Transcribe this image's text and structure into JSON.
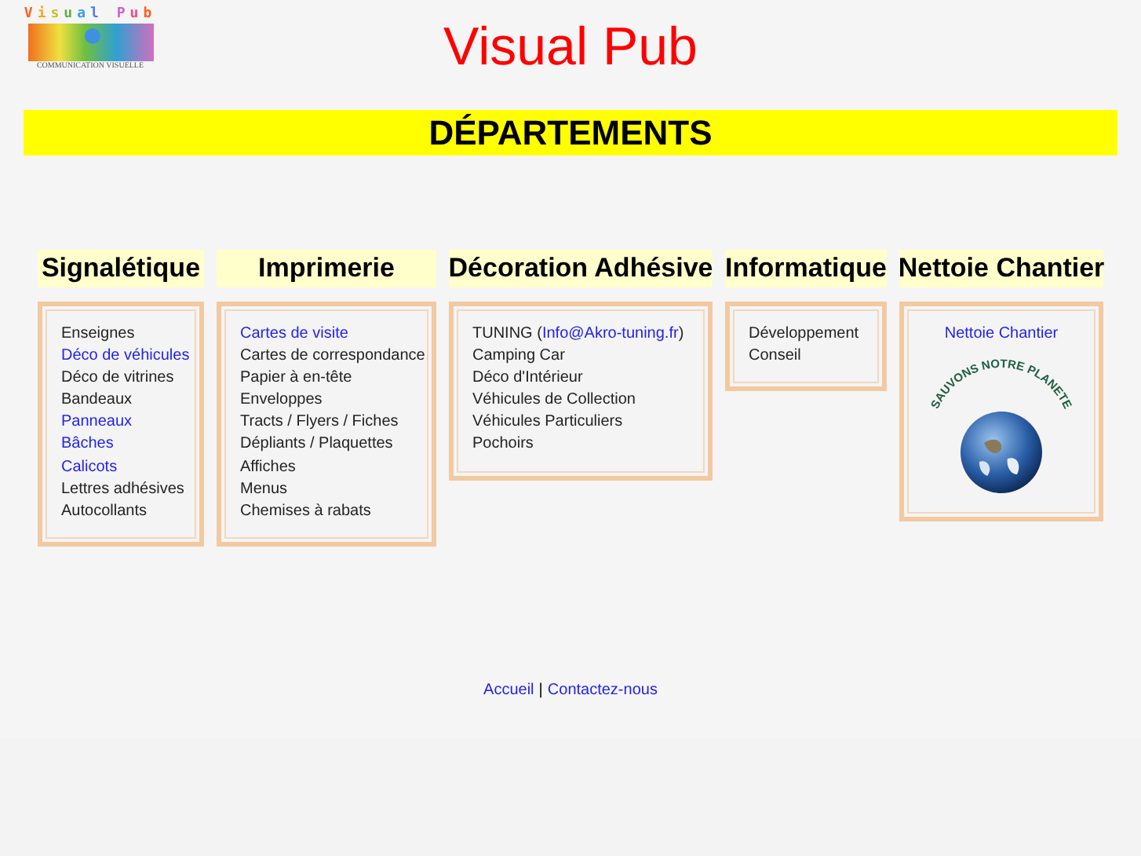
{
  "logo": {
    "name": "Visual Pub",
    "tagline": "COMMUNICATION VISUELLE"
  },
  "title": "Visual Pub",
  "banner": "DÉPARTEMENTS",
  "departments": [
    {
      "heading": "Signalétique",
      "kind": "list",
      "items": [
        {
          "parts": [
            {
              "text": "Enseignes",
              "link": false
            }
          ]
        },
        {
          "parts": [
            {
              "text": "Déco de véhicules",
              "link": true
            }
          ]
        },
        {
          "parts": [
            {
              "text": "Déco de vitrines",
              "link": false
            }
          ]
        },
        {
          "parts": [
            {
              "text": "Bandeaux",
              "link": false
            }
          ]
        },
        {
          "parts": [
            {
              "text": "Panneaux",
              "link": true
            }
          ]
        },
        {
          "parts": [
            {
              "text": "Bâches",
              "link": true
            }
          ]
        },
        {
          "parts": [
            {
              "text": "Calicots",
              "link": true
            }
          ]
        },
        {
          "parts": [
            {
              "text": "Lettres adhésives",
              "link": false
            }
          ]
        },
        {
          "parts": [
            {
              "text": "Autocollants",
              "link": false
            }
          ]
        }
      ]
    },
    {
      "heading": "Imprimerie",
      "kind": "list",
      "items": [
        {
          "parts": [
            {
              "text": "Cartes de visite",
              "link": true
            }
          ]
        },
        {
          "parts": [
            {
              "text": "Cartes de correspondance",
              "link": false
            }
          ]
        },
        {
          "parts": [
            {
              "text": "Papier à en-tête",
              "link": false
            }
          ]
        },
        {
          "parts": [
            {
              "text": "Enveloppes",
              "link": false
            }
          ]
        },
        {
          "parts": [
            {
              "text": "Tracts / Flyers / Fiches",
              "link": false
            }
          ]
        },
        {
          "parts": [
            {
              "text": "Dépliants / Plaquettes",
              "link": false
            }
          ]
        },
        {
          "parts": [
            {
              "text": "Affiches",
              "link": false
            }
          ]
        },
        {
          "parts": [
            {
              "text": "Menus",
              "link": false
            }
          ]
        },
        {
          "parts": [
            {
              "text": "Chemises à rabats",
              "link": false
            }
          ]
        }
      ]
    },
    {
      "heading": "Décoration Adhésive",
      "kind": "list",
      "items": [
        {
          "parts": [
            {
              "text": "TUNING (",
              "link": false
            },
            {
              "text": "Info@Akro-tuning.fr",
              "link": true
            },
            {
              "text": ")",
              "link": false
            }
          ]
        },
        {
          "parts": [
            {
              "text": "Camping Car",
              "link": false
            }
          ]
        },
        {
          "parts": [
            {
              "text": "Déco d'Intérieur",
              "link": false
            }
          ]
        },
        {
          "parts": [
            {
              "text": "Véhicules de Collection",
              "link": false
            }
          ]
        },
        {
          "parts": [
            {
              "text": "Véhicules Particuliers",
              "link": false
            }
          ]
        },
        {
          "parts": [
            {
              "text": "Pochoirs",
              "link": false
            }
          ]
        }
      ]
    },
    {
      "heading": "Informatique",
      "kind": "list",
      "items": [
        {
          "parts": [
            {
              "text": "Développement",
              "link": false
            }
          ]
        },
        {
          "parts": [
            {
              "text": "Conseil",
              "link": false
            }
          ]
        }
      ]
    },
    {
      "heading": "Nettoie Chantier",
      "kind": "badge",
      "link": "Nettoie Chantier",
      "badge_text": "SAUVONS NOTRE PLANETE"
    }
  ],
  "footer": [
    {
      "text": "Accueil"
    },
    {
      "text": "Contactez-nous"
    }
  ],
  "footer_separator": "|"
}
